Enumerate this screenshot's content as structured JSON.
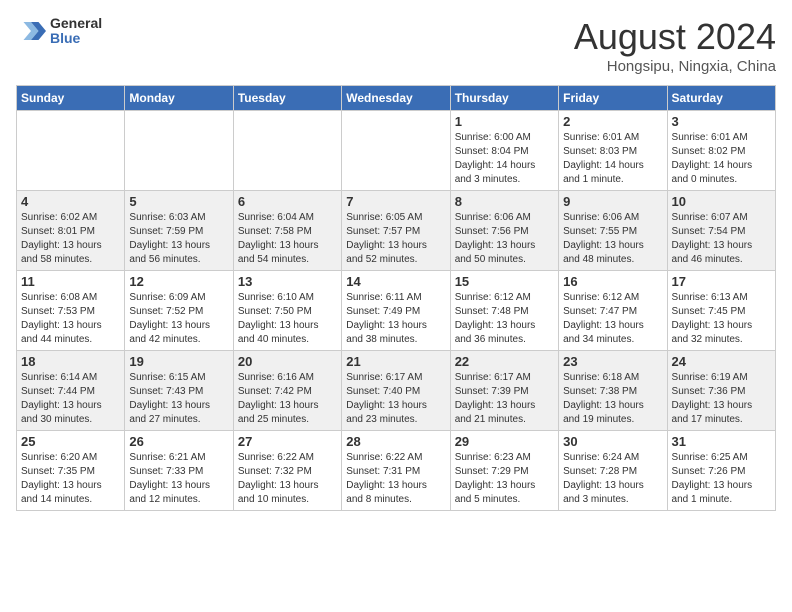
{
  "header": {
    "logo_general": "General",
    "logo_blue": "Blue",
    "month": "August 2024",
    "location": "Hongsipu, Ningxia, China"
  },
  "days_of_week": [
    "Sunday",
    "Monday",
    "Tuesday",
    "Wednesday",
    "Thursday",
    "Friday",
    "Saturday"
  ],
  "weeks": [
    [
      {
        "day": "",
        "info": ""
      },
      {
        "day": "",
        "info": ""
      },
      {
        "day": "",
        "info": ""
      },
      {
        "day": "",
        "info": ""
      },
      {
        "day": "1",
        "info": "Sunrise: 6:00 AM\nSunset: 8:04 PM\nDaylight: 14 hours\nand 3 minutes."
      },
      {
        "day": "2",
        "info": "Sunrise: 6:01 AM\nSunset: 8:03 PM\nDaylight: 14 hours\nand 1 minute."
      },
      {
        "day": "3",
        "info": "Sunrise: 6:01 AM\nSunset: 8:02 PM\nDaylight: 14 hours\nand 0 minutes."
      }
    ],
    [
      {
        "day": "4",
        "info": "Sunrise: 6:02 AM\nSunset: 8:01 PM\nDaylight: 13 hours\nand 58 minutes."
      },
      {
        "day": "5",
        "info": "Sunrise: 6:03 AM\nSunset: 7:59 PM\nDaylight: 13 hours\nand 56 minutes."
      },
      {
        "day": "6",
        "info": "Sunrise: 6:04 AM\nSunset: 7:58 PM\nDaylight: 13 hours\nand 54 minutes."
      },
      {
        "day": "7",
        "info": "Sunrise: 6:05 AM\nSunset: 7:57 PM\nDaylight: 13 hours\nand 52 minutes."
      },
      {
        "day": "8",
        "info": "Sunrise: 6:06 AM\nSunset: 7:56 PM\nDaylight: 13 hours\nand 50 minutes."
      },
      {
        "day": "9",
        "info": "Sunrise: 6:06 AM\nSunset: 7:55 PM\nDaylight: 13 hours\nand 48 minutes."
      },
      {
        "day": "10",
        "info": "Sunrise: 6:07 AM\nSunset: 7:54 PM\nDaylight: 13 hours\nand 46 minutes."
      }
    ],
    [
      {
        "day": "11",
        "info": "Sunrise: 6:08 AM\nSunset: 7:53 PM\nDaylight: 13 hours\nand 44 minutes."
      },
      {
        "day": "12",
        "info": "Sunrise: 6:09 AM\nSunset: 7:52 PM\nDaylight: 13 hours\nand 42 minutes."
      },
      {
        "day": "13",
        "info": "Sunrise: 6:10 AM\nSunset: 7:50 PM\nDaylight: 13 hours\nand 40 minutes."
      },
      {
        "day": "14",
        "info": "Sunrise: 6:11 AM\nSunset: 7:49 PM\nDaylight: 13 hours\nand 38 minutes."
      },
      {
        "day": "15",
        "info": "Sunrise: 6:12 AM\nSunset: 7:48 PM\nDaylight: 13 hours\nand 36 minutes."
      },
      {
        "day": "16",
        "info": "Sunrise: 6:12 AM\nSunset: 7:47 PM\nDaylight: 13 hours\nand 34 minutes."
      },
      {
        "day": "17",
        "info": "Sunrise: 6:13 AM\nSunset: 7:45 PM\nDaylight: 13 hours\nand 32 minutes."
      }
    ],
    [
      {
        "day": "18",
        "info": "Sunrise: 6:14 AM\nSunset: 7:44 PM\nDaylight: 13 hours\nand 30 minutes."
      },
      {
        "day": "19",
        "info": "Sunrise: 6:15 AM\nSunset: 7:43 PM\nDaylight: 13 hours\nand 27 minutes."
      },
      {
        "day": "20",
        "info": "Sunrise: 6:16 AM\nSunset: 7:42 PM\nDaylight: 13 hours\nand 25 minutes."
      },
      {
        "day": "21",
        "info": "Sunrise: 6:17 AM\nSunset: 7:40 PM\nDaylight: 13 hours\nand 23 minutes."
      },
      {
        "day": "22",
        "info": "Sunrise: 6:17 AM\nSunset: 7:39 PM\nDaylight: 13 hours\nand 21 minutes."
      },
      {
        "day": "23",
        "info": "Sunrise: 6:18 AM\nSunset: 7:38 PM\nDaylight: 13 hours\nand 19 minutes."
      },
      {
        "day": "24",
        "info": "Sunrise: 6:19 AM\nSunset: 7:36 PM\nDaylight: 13 hours\nand 17 minutes."
      }
    ],
    [
      {
        "day": "25",
        "info": "Sunrise: 6:20 AM\nSunset: 7:35 PM\nDaylight: 13 hours\nand 14 minutes."
      },
      {
        "day": "26",
        "info": "Sunrise: 6:21 AM\nSunset: 7:33 PM\nDaylight: 13 hours\nand 12 minutes."
      },
      {
        "day": "27",
        "info": "Sunrise: 6:22 AM\nSunset: 7:32 PM\nDaylight: 13 hours\nand 10 minutes."
      },
      {
        "day": "28",
        "info": "Sunrise: 6:22 AM\nSunset: 7:31 PM\nDaylight: 13 hours\nand 8 minutes."
      },
      {
        "day": "29",
        "info": "Sunrise: 6:23 AM\nSunset: 7:29 PM\nDaylight: 13 hours\nand 5 minutes."
      },
      {
        "day": "30",
        "info": "Sunrise: 6:24 AM\nSunset: 7:28 PM\nDaylight: 13 hours\nand 3 minutes."
      },
      {
        "day": "31",
        "info": "Sunrise: 6:25 AM\nSunset: 7:26 PM\nDaylight: 13 hours\nand 1 minute."
      }
    ]
  ]
}
